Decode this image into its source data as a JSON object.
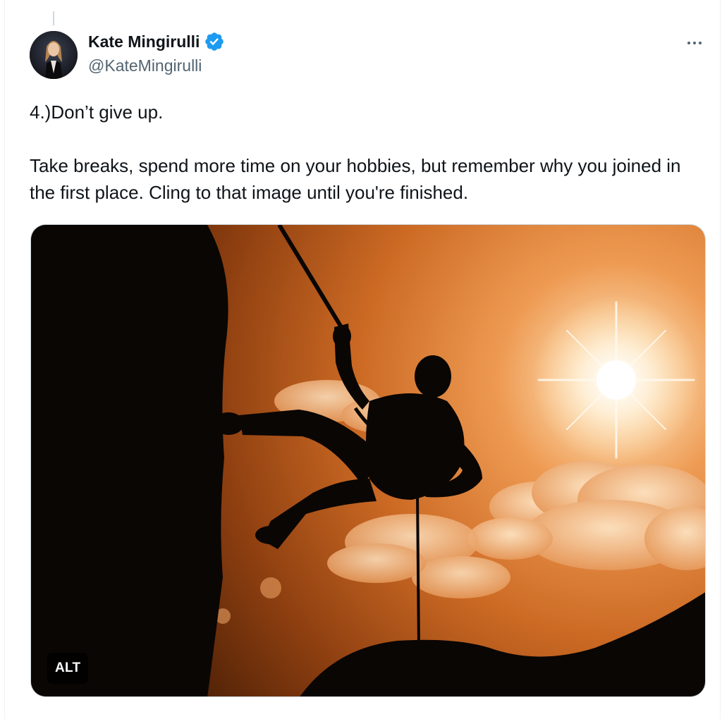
{
  "author": {
    "name": "Kate Mingirulli",
    "handle": "@KateMingirulli",
    "verified": true
  },
  "tweet": {
    "paragraphs": [
      "4.)Don’t give up.",
      "Take breaks, spend more time on your hobbies, but remember why you joined in the first place. Cling to that image until you're finished."
    ]
  },
  "media": {
    "alt_badge": "ALT"
  },
  "icons": {
    "verified": "verified-badge-icon",
    "more": "more-options-icon"
  },
  "colors": {
    "text": "#0f1419",
    "secondary": "#536471",
    "verified": "#1d9bf0"
  }
}
